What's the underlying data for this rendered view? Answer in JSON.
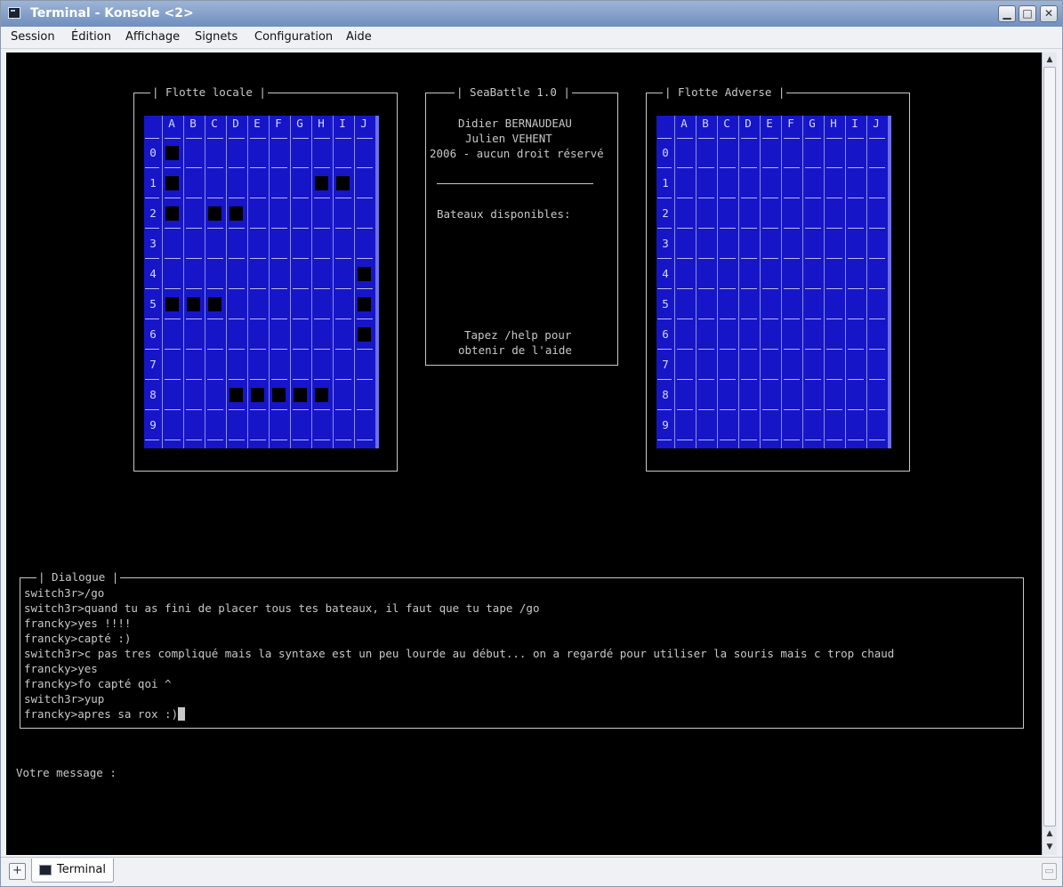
{
  "window": {
    "title": "Terminal - Konsole <2>",
    "btn_min": "▁",
    "btn_max": "□",
    "btn_close": "✕"
  },
  "menu": [
    "Session",
    "Édition",
    "Affichage",
    "Signets",
    "Configuration",
    "Aide"
  ],
  "boards": {
    "columns": [
      "A",
      "B",
      "C",
      "D",
      "E",
      "F",
      "G",
      "H",
      "I",
      "J"
    ],
    "rows": [
      "0",
      "1",
      "2",
      "3",
      "4",
      "5",
      "6",
      "7",
      "8",
      "9"
    ],
    "local": {
      "title": "| Flotte locale |",
      "ships": [
        [
          0,
          0
        ],
        [
          0,
          1
        ],
        [
          7,
          1
        ],
        [
          8,
          1
        ],
        [
          0,
          2
        ],
        [
          2,
          2
        ],
        [
          3,
          2
        ],
        [
          9,
          4
        ],
        [
          0,
          5
        ],
        [
          1,
          5
        ],
        [
          2,
          5
        ],
        [
          9,
          5
        ],
        [
          9,
          6
        ],
        [
          3,
          8
        ],
        [
          4,
          8
        ],
        [
          5,
          8
        ],
        [
          6,
          8
        ],
        [
          7,
          8
        ]
      ]
    },
    "adverse": {
      "title": "| Flotte Adverse |",
      "ships": []
    }
  },
  "info": {
    "title": "| SeaBattle 1.0 |",
    "authors": "Didier BERNAUDEAU",
    "author2": "Julien VEHENT",
    "rights": "2006 - aucun droit réservé",
    "boats_label": "Bateaux disponibles:",
    "help_line1": "Tapez /help pour",
    "help_line2": "obtenir de l'aide"
  },
  "dialogue": {
    "title": "| Dialogue |",
    "lines": [
      "switch3r>/go",
      "switch3r>quand tu as fini de placer tous tes bateaux, il faut que tu tape /go",
      "francky>yes !!!!",
      "francky>capté :)",
      "switch3r>c pas tres compliqué mais la syntaxe est un peu lourde au début... on a regardé pour utiliser la souris mais c trop chaud",
      "francky>yes",
      "francky>fo capté qoi ^",
      "switch3r>yup",
      "francky>apres sa rox :)"
    ]
  },
  "prompt": {
    "label": "Votre message :"
  },
  "tabs": {
    "new_tab": "+",
    "active": "Terminal",
    "close": "▭"
  }
}
